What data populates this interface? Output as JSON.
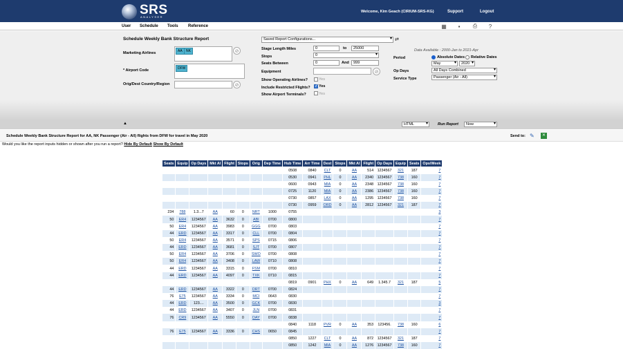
{
  "brand": {
    "name": "SRS",
    "sub": "ANALYSER"
  },
  "header": {
    "welcome": "Welcome, Kim Geach (CIRIUM-SRS-KG)",
    "support": "Support",
    "logout": "Logout"
  },
  "menu": [
    "User",
    "Schedule",
    "Tools",
    "Reference"
  ],
  "toolbar_icons": [
    "grid-icon",
    "save-icon",
    "print-icon",
    "help-icon"
  ],
  "form": {
    "report_title": "Schedule Weekly Bank Structure Report",
    "saved_configs": "Saved Report Configurations...",
    "marketing_label": "Marketing Airlines",
    "marketing_tags": [
      "AA",
      "NK"
    ],
    "airport_label": "* Airport Code",
    "airport_tags": [
      "DFW"
    ],
    "origdest_label": "Orig/Dest Country/Region",
    "stage_label": "Stage Length Miles",
    "stage_from": "0",
    "stage_to_label": "to",
    "stage_to": "25000",
    "stops_label": "Stops",
    "stops_value": "0",
    "seats_label": "Seats Between",
    "seats_from": "0",
    "seats_and": "And",
    "seats_to": "999",
    "equipment_label": "Equipment",
    "show_op_label": "Show Operating Airlines?",
    "show_op_yes": "Yes",
    "include_label": "Include Restricted Flights?",
    "include_yes": "Yes",
    "terminals_label": "Show Airport Terminals?",
    "terminals_yes": "Yes",
    "available": "Data Available : 2000-Jan to 2021-Apr",
    "period_label": "Period",
    "absolute": "Absolute Dates",
    "relative": "Relative Dates",
    "month": "May",
    "year": "2020",
    "opdays_label": "Op Days",
    "opdays_value": "All Days Combined",
    "service_label": "Service Type",
    "service_value": "Passenger (Air - All)",
    "format_value": "HTML",
    "run_label": "Run Report",
    "run_value": "Now"
  },
  "result": {
    "title": "Schedule Weekly Bank Structure Report for AA, NK Passenger (Air - All) flights from DFW for travel in May 2020",
    "send_to": "Send to:",
    "hint": "Would you like the report inputs hidden or shown after you run a report?",
    "hide": "Hide By Default",
    "show": "Show By Default"
  },
  "table": {
    "headers": [
      "Seats",
      "Equip",
      "Op Days",
      "Mkt Al",
      "Flight",
      "Stops",
      "Orig",
      "Dep Time",
      "Hub Time",
      "Arr Time",
      "Dest",
      "Stops",
      "Mkt Al",
      "Flight",
      "Op Days",
      "Equip",
      "Seats",
      "Ops/Week"
    ],
    "rows": [
      [
        "",
        "",
        "",
        "",
        "",
        "",
        "",
        "",
        "0508",
        "0840",
        "CLT",
        "0",
        "AA",
        "514",
        "1234567",
        "321",
        "187",
        "7"
      ],
      [
        "",
        "",
        "",
        "",
        "",
        "",
        "",
        "",
        "0530",
        "0941",
        "PHL",
        "0",
        "AA",
        "2340",
        "1234567",
        "738",
        "160",
        "7"
      ],
      [
        "",
        "",
        "",
        "",
        "",
        "",
        "",
        "",
        "0600",
        "0943",
        "MIA",
        "0",
        "AA",
        "2348",
        "1234567",
        "738",
        "160",
        "7"
      ],
      [
        "",
        "",
        "",
        "",
        "",
        "",
        "",
        "",
        "0725",
        "1120",
        "MIA",
        "0",
        "AA",
        "2386",
        "1234567",
        "738",
        "160",
        "7"
      ],
      [
        "",
        "",
        "",
        "",
        "",
        "",
        "",
        "",
        "0730",
        "0857",
        "LAX",
        "0",
        "AA",
        "1295",
        "1234567",
        "738",
        "160",
        "7"
      ],
      [
        "",
        "",
        "",
        "",
        "",
        "",
        "",
        "",
        "0730",
        "0959",
        "ORD",
        "0",
        "AA",
        "2812",
        "1234567",
        "321",
        "187",
        "7"
      ],
      [
        "234",
        "788",
        "1.3...7",
        "AA",
        "60",
        "0",
        "NRT",
        "1000",
        "0755",
        "",
        "",
        "",
        "",
        "",
        "",
        "",
        "",
        "3"
      ],
      [
        "50",
        "ER4",
        "1234567",
        "AA",
        "3632",
        "0",
        "ABI",
        "0700",
        "0800",
        "",
        "",
        "",
        "",
        "",
        "",
        "",
        "",
        "7"
      ],
      [
        "50",
        "ER4",
        "1234567",
        "AA",
        "3983",
        "0",
        "GGG",
        "0700",
        "0803",
        "",
        "",
        "",
        "",
        "",
        "",
        "",
        "",
        "7"
      ],
      [
        "44",
        "ERD",
        "1234567",
        "AA",
        "3317",
        "0",
        "CLL",
        "0700",
        "0804",
        "",
        "",
        "",
        "",
        "",
        "",
        "",
        "",
        "7"
      ],
      [
        "50",
        "ER4",
        "1234567",
        "AA",
        "3571",
        "0",
        "SPS",
        "0715",
        "0806",
        "",
        "",
        "",
        "",
        "",
        "",
        "",
        "",
        "7"
      ],
      [
        "44",
        "ERD",
        "1234567",
        "AA",
        "3681",
        "0",
        "SJT",
        "0700",
        "0807",
        "",
        "",
        "",
        "",
        "",
        "",
        "",
        "",
        "7"
      ],
      [
        "50",
        "ER4",
        "1234567",
        "AA",
        "3706",
        "0",
        "SWO",
        "0700",
        "0808",
        "",
        "",
        "",
        "",
        "",
        "",
        "",
        "",
        "7"
      ],
      [
        "50",
        "ER4",
        "1234567",
        "AA",
        "3408",
        "0",
        "LAW",
        "0710",
        "0808",
        "",
        "",
        "",
        "",
        "",
        "",
        "",
        "",
        "7"
      ],
      [
        "44",
        "ERD",
        "1234567",
        "AA",
        "3315",
        "0",
        "FSM",
        "0700",
        "0810",
        "",
        "",
        "",
        "",
        "",
        "",
        "",
        "",
        "7"
      ],
      [
        "44",
        "ERD",
        "1234567",
        "AA",
        "4097",
        "0",
        "TXK",
        "0710",
        "0815",
        "",
        "",
        "",
        "",
        "",
        "",
        "",
        "",
        "7"
      ],
      [
        "",
        "",
        "",
        "",
        "",
        "",
        "",
        "",
        "0819",
        "0901",
        "PHX",
        "0",
        "AA",
        "649",
        "1.345.7",
        "321",
        "187",
        "5"
      ],
      [
        "44",
        "ERD",
        "1234567",
        "AA",
        "3322",
        "0",
        "DRT",
        "0700",
        "0824",
        "",
        "",
        "",
        "",
        "",
        "",
        "",
        "",
        "7"
      ],
      [
        "76",
        "E75",
        "1234567",
        "AA",
        "3334",
        "0",
        "MCI",
        "0643",
        "0830",
        "",
        "",
        "",
        "",
        "",
        "",
        "",
        "",
        "7"
      ],
      [
        "44",
        "ERD",
        "123....",
        "AA",
        "3500",
        "0",
        "GCK",
        "0700",
        "0830",
        "",
        "",
        "",
        "",
        "",
        "",
        "",
        "",
        "3"
      ],
      [
        "44",
        "ERD",
        "1234567",
        "AA",
        "3407",
        "0",
        "JLN",
        "0700",
        "0831",
        "",
        "",
        "",
        "",
        "",
        "",
        "",
        "",
        "7"
      ],
      [
        "76",
        "CR9",
        "1234567",
        "AA",
        "5550",
        "0",
        "DAY",
        "0700",
        "0838",
        "",
        "",
        "",
        "",
        "",
        "",
        "",
        "",
        "7"
      ],
      [
        "",
        "",
        "",
        "",
        "",
        "",
        "",
        "",
        "0840",
        "1118",
        "PVR",
        "0",
        "AA",
        "353",
        "123456.",
        "738",
        "160",
        "6"
      ],
      [
        "76",
        "E75",
        "1234567",
        "AA",
        "3336",
        "0",
        "CHS",
        "0650",
        "0845",
        "",
        "",
        "",
        "",
        "",
        "",
        "",
        "",
        "7"
      ],
      [
        "",
        "",
        "",
        "",
        "",
        "",
        "",
        "",
        "0850",
        "1227",
        "CLT",
        "0",
        "AA",
        "872",
        "1234567",
        "321",
        "187",
        "7"
      ],
      [
        "",
        "",
        "",
        "",
        "",
        "",
        "",
        "",
        "0850",
        "1242",
        "MIA",
        "0",
        "AA",
        "1276",
        "1234567",
        "738",
        "160",
        "7"
      ]
    ]
  }
}
